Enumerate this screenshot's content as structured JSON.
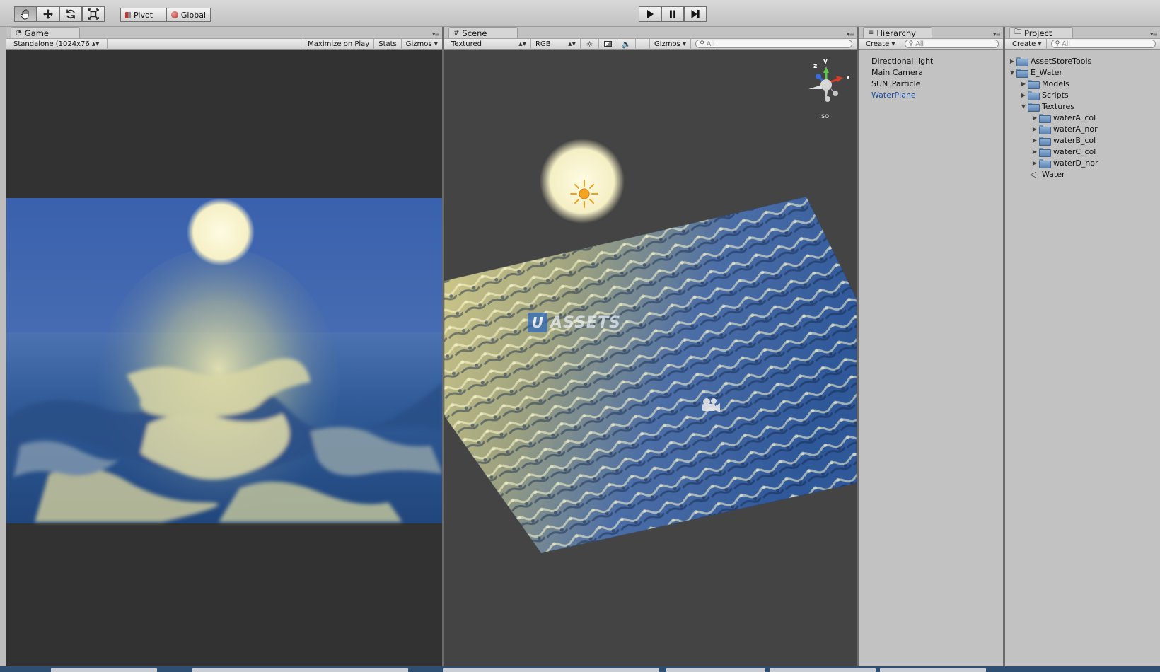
{
  "toolbar": {
    "tools": [
      {
        "name": "hand-tool",
        "icon": "hand-icon"
      },
      {
        "name": "move-tool",
        "icon": "move-icon"
      },
      {
        "name": "rotate-tool",
        "icon": "rotate-icon"
      },
      {
        "name": "scale-tool",
        "icon": "scale-icon"
      }
    ],
    "pivot_label": "Pivot",
    "global_label": "Global",
    "play_icon": "play-icon",
    "pause_icon": "pause-icon",
    "step_icon": "step-icon"
  },
  "game": {
    "tab_label": "Game",
    "resolution": "Standalone (1024x76",
    "maximize_label": "Maximize on Play",
    "stats_label": "Stats",
    "gizmos_label": "Gizmos"
  },
  "scene": {
    "tab_label": "Scene",
    "render_mode": "Textured",
    "color_mode": "RGB",
    "gizmos_label": "Gizmos",
    "search_placeholder": "All",
    "gizmo_axes": {
      "x": "x",
      "y": "y",
      "z": "z"
    },
    "projection_label": "Iso",
    "watermark": "ASSETS",
    "watermark_letter": "U"
  },
  "hierarchy": {
    "tab_label": "Hierarchy",
    "create_label": "Create",
    "search_placeholder": "All",
    "items": [
      {
        "label": "Directional light",
        "selected": false
      },
      {
        "label": "Main Camera",
        "selected": false
      },
      {
        "label": "SUN_Particle",
        "selected": false
      },
      {
        "label": "WaterPlane",
        "selected": true
      }
    ]
  },
  "project": {
    "tab_label": "Project",
    "create_label": "Create",
    "search_placeholder": "All",
    "items": [
      {
        "label": "AssetStoreTools",
        "depth": 0,
        "arrow": "collapsed",
        "kind": "folder"
      },
      {
        "label": "E_Water",
        "depth": 0,
        "arrow": "expanded",
        "kind": "folder"
      },
      {
        "label": "Models",
        "depth": 1,
        "arrow": "collapsed",
        "kind": "folder"
      },
      {
        "label": "Scripts",
        "depth": 1,
        "arrow": "collapsed",
        "kind": "folder"
      },
      {
        "label": "Textures",
        "depth": 1,
        "arrow": "expanded",
        "kind": "folder"
      },
      {
        "label": "waterA_col",
        "depth": 2,
        "arrow": "collapsed",
        "kind": "folder"
      },
      {
        "label": "waterA_nor",
        "depth": 2,
        "arrow": "collapsed",
        "kind": "folder"
      },
      {
        "label": "waterB_col",
        "depth": 2,
        "arrow": "collapsed",
        "kind": "folder"
      },
      {
        "label": "waterC_col",
        "depth": 2,
        "arrow": "collapsed",
        "kind": "folder"
      },
      {
        "label": "waterD_nor",
        "depth": 2,
        "arrow": "collapsed",
        "kind": "folder"
      },
      {
        "label": "Water",
        "depth": 1,
        "arrow": "none",
        "kind": "unity"
      }
    ]
  },
  "colors": {
    "selected_text": "#1f4e9c",
    "sky_blue": "#3d63ad",
    "scene_bg": "#424242",
    "game_bg": "#323232",
    "sun": "#fbf7d2"
  }
}
